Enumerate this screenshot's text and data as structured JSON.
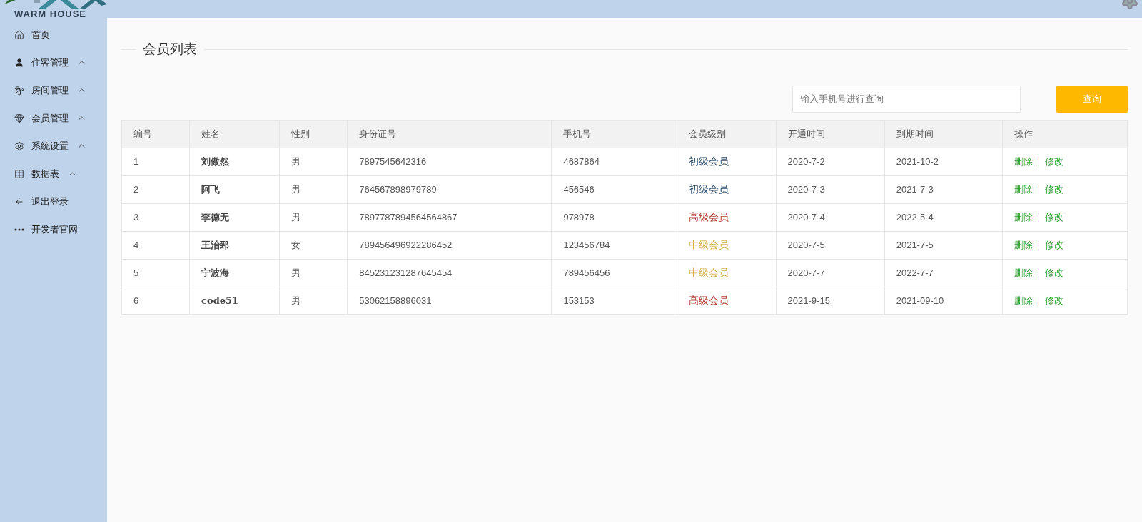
{
  "logo": {
    "text": "WARM HOUSE"
  },
  "sidebar": {
    "items": [
      {
        "label": "首页",
        "expandable": false
      },
      {
        "label": "住客管理",
        "expandable": true
      },
      {
        "label": "房间管理",
        "expandable": true
      },
      {
        "label": "会员管理",
        "expandable": true
      },
      {
        "label": "系统设置",
        "expandable": true
      },
      {
        "label": "数据表",
        "expandable": true
      },
      {
        "label": "退出登录",
        "expandable": false
      },
      {
        "label": "开发者官网",
        "expandable": false
      }
    ]
  },
  "page_title": "会员列表",
  "search": {
    "placeholder": "输入手机号进行查询",
    "button": "查询"
  },
  "table": {
    "columns": [
      "编号",
      "姓名",
      "性别",
      "身份证号",
      "手机号",
      "会员级别",
      "开通时间",
      "到期时间",
      "操作"
    ],
    "rows": [
      {
        "id": "1",
        "name": "刘傲然",
        "gender": "男",
        "id_card": "7897545642316",
        "phone": "4687864",
        "level": "初级会员",
        "color": "#2f4f6f",
        "start": "2020-7-2",
        "end": "2021-10-2",
        "actions": [
          "删除",
          "修改"
        ]
      },
      {
        "id": "2",
        "name": "阿飞",
        "gender": "男",
        "id_card": "764567898979789",
        "phone": "456546",
        "level": "初级会员",
        "color": "#2f4f6f",
        "start": "2020-7-3",
        "end": "2021-7-3",
        "actions": [
          "删除",
          "修改"
        ]
      },
      {
        "id": "3",
        "name": "李德无",
        "gender": "男",
        "id_card": "7897787894564564867",
        "phone": "978978",
        "level": "高级会员",
        "color": "#b03a2e",
        "start": "2020-7-4",
        "end": "2022-5-4",
        "actions": [
          "删除",
          "修改"
        ]
      },
      {
        "id": "4",
        "name": "王治郅",
        "gender": "女",
        "id_card": "789456496922286452",
        "phone": "123456784",
        "level": "中级会员",
        "color": "#d4b04a",
        "start": "2020-7-5",
        "end": "2021-7-5",
        "actions": [
          "删除",
          "修改"
        ]
      },
      {
        "id": "5",
        "name": "宁波海",
        "gender": "男",
        "id_card": "845231231287645454",
        "phone": "789456456",
        "level": "中级会员",
        "color": "#d4b04a",
        "start": "2020-7-7",
        "end": "2022-7-7",
        "actions": [
          "删除",
          "修改"
        ]
      },
      {
        "id": "6",
        "name": "code51",
        "gender": "男",
        "id_card": "53062158896031",
        "phone": "153153",
        "level": "高级会员",
        "color": "#b03a2e",
        "start": "2021-9-15",
        "end": "2021-09-10",
        "actions": [
          "删除",
          "修改"
        ]
      }
    ]
  }
}
